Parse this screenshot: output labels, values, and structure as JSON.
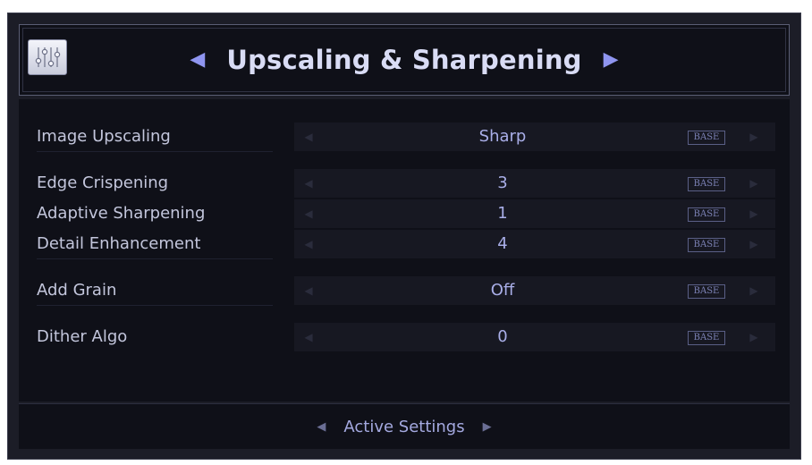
{
  "header": {
    "title": "Upscaling & Sharpening",
    "prev_arrow": "◀",
    "next_arrow": "▶",
    "icon": "sliders-icon"
  },
  "settings": [
    {
      "label": "Image Upscaling",
      "value": "Sharp",
      "badge": "BASE"
    },
    {
      "label": "Edge Crispening",
      "value": "3",
      "badge": "BASE"
    },
    {
      "label": "Adaptive Sharpening",
      "value": "1",
      "badge": "BASE"
    },
    {
      "label": "Detail Enhancement",
      "value": "4",
      "badge": "BASE"
    },
    {
      "label": "Add Grain",
      "value": "Off",
      "badge": "BASE"
    },
    {
      "label": "Dither Algo",
      "value": "0",
      "badge": "BASE"
    }
  ],
  "footer": {
    "label": "Active Settings",
    "prev_arrow": "◀",
    "next_arrow": "▶"
  },
  "colors": {
    "accent": "#8f95f0",
    "background": "#0f1018",
    "frame": "#1c1d27",
    "label_text": "#c3c6dc",
    "value_text": "#a9aee8"
  }
}
